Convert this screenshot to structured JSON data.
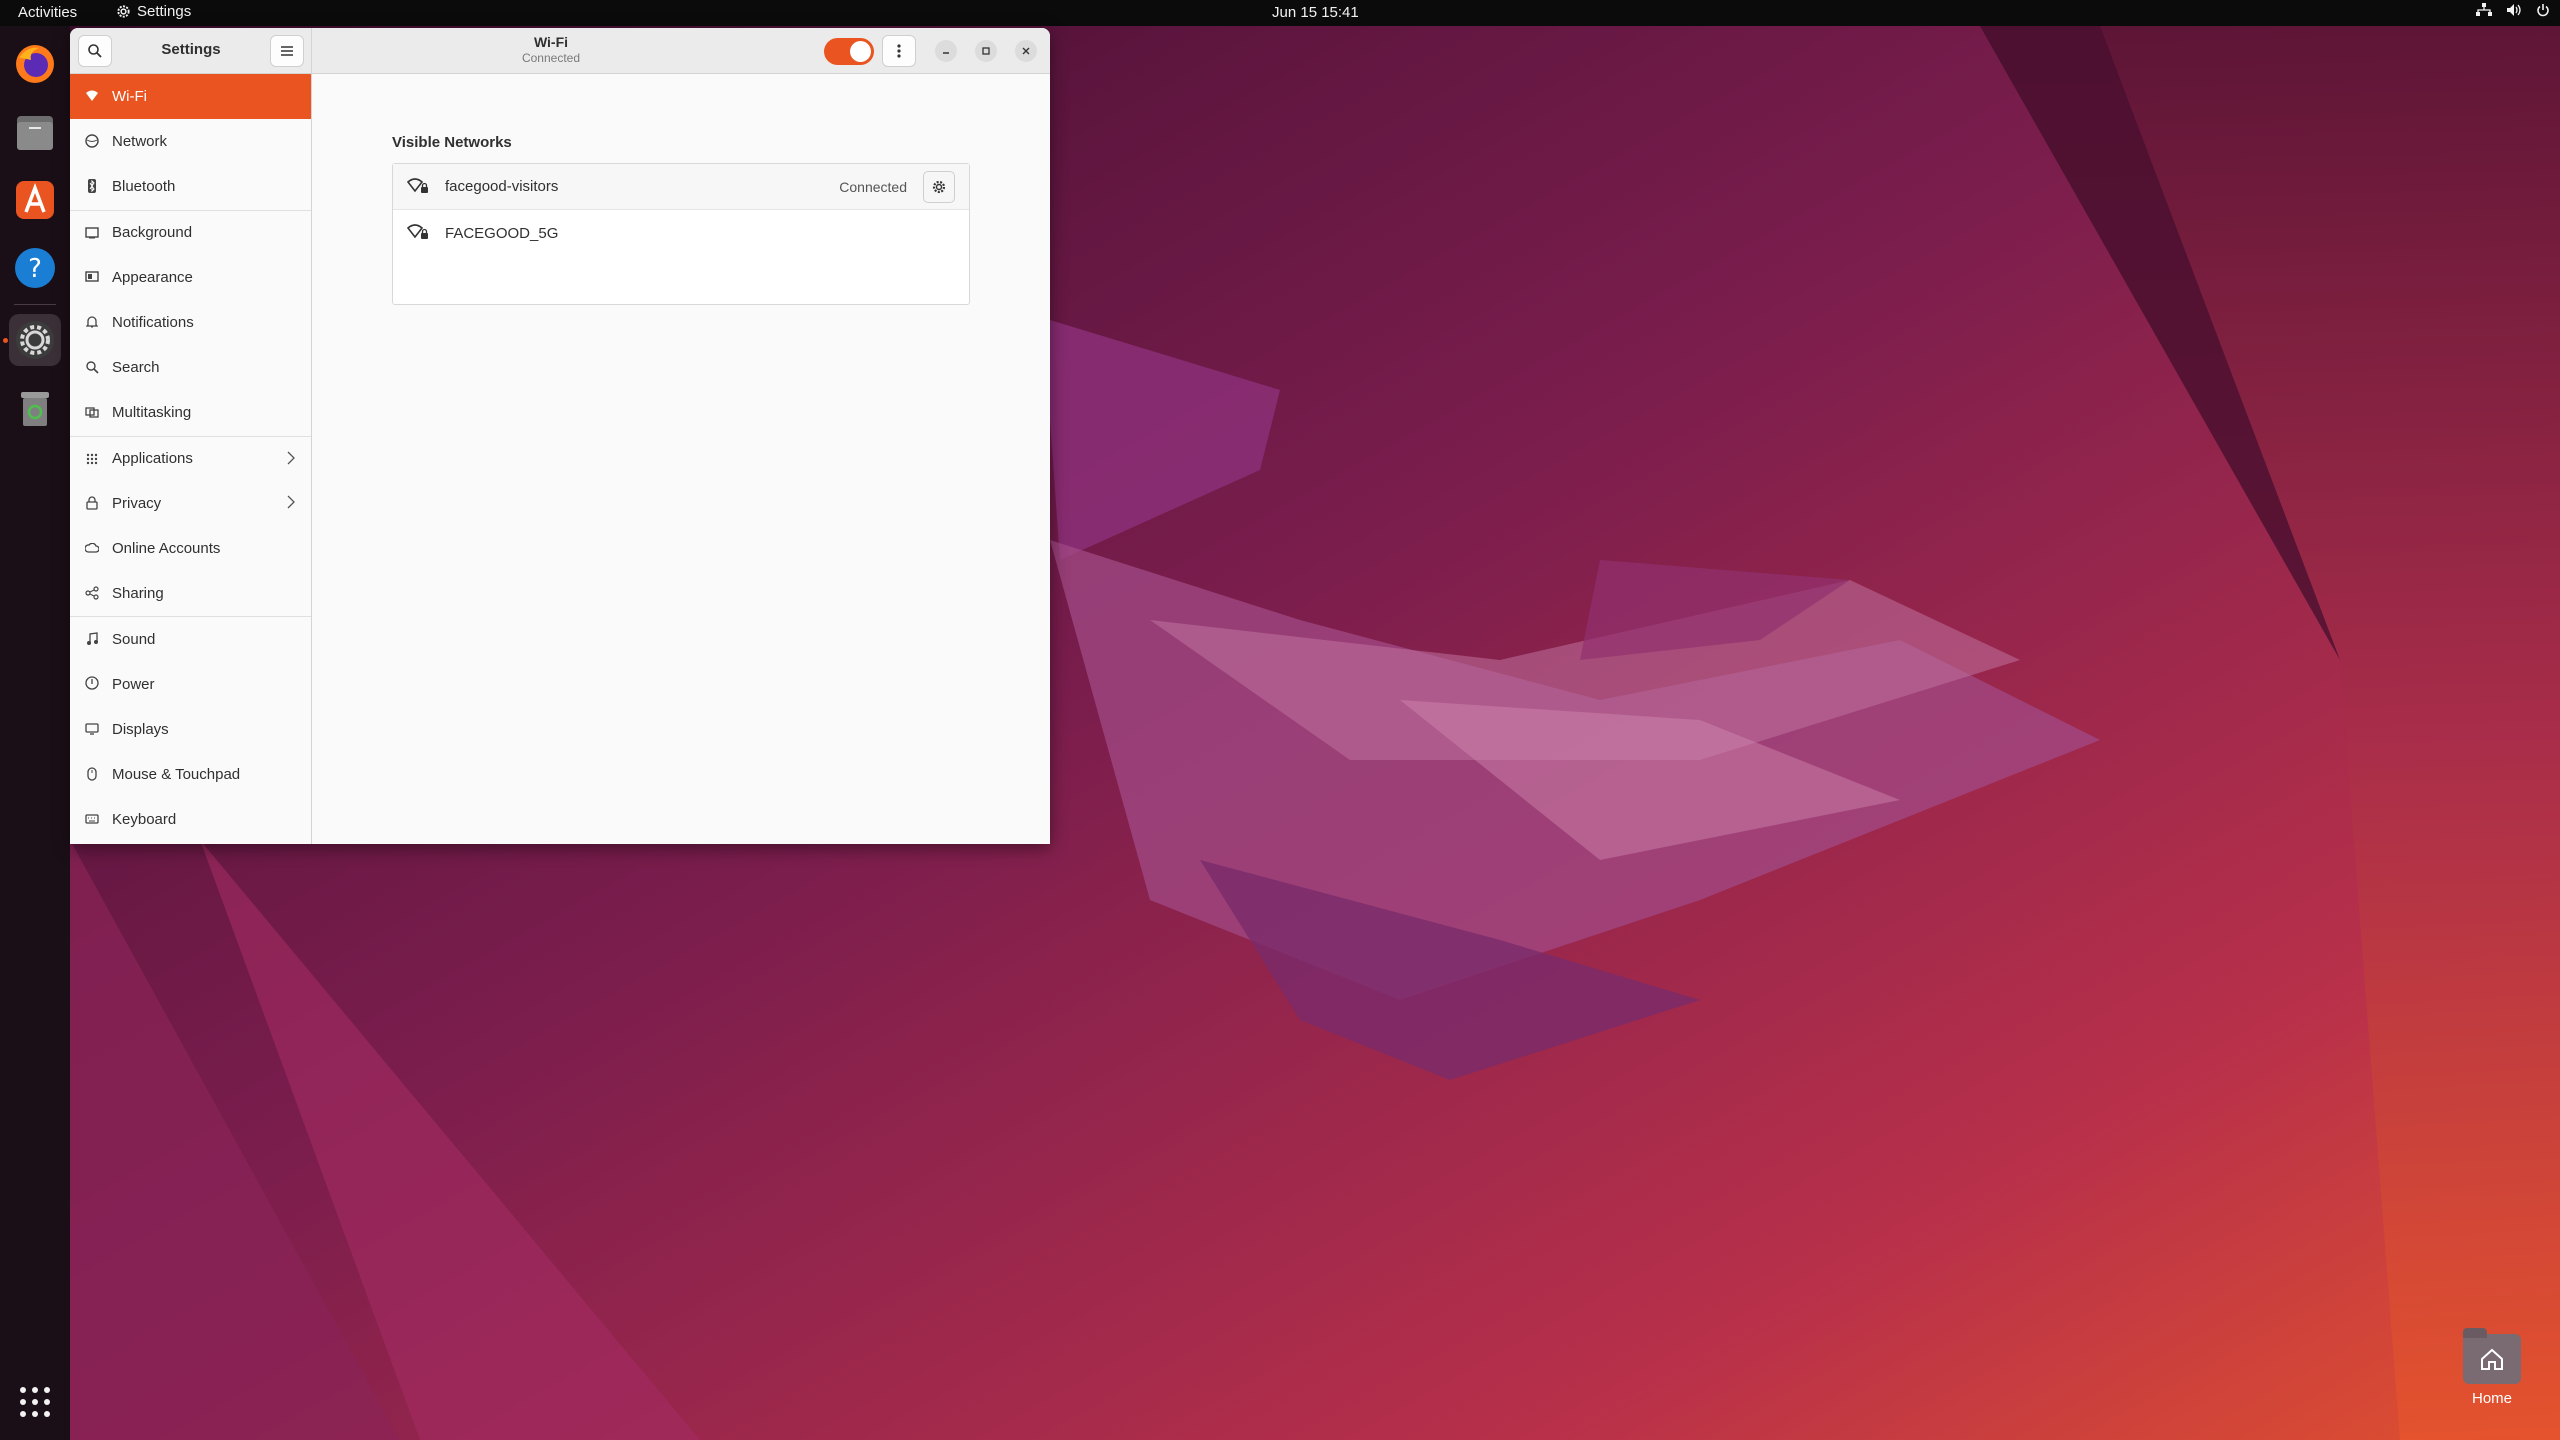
{
  "topbar": {
    "activities": "Activities",
    "app_name": "Settings",
    "clock": "Jun 15  15:41"
  },
  "dock": {
    "items": [
      {
        "name": "firefox-icon"
      },
      {
        "name": "files-icon"
      },
      {
        "name": "app-center-icon"
      },
      {
        "name": "help-icon"
      },
      {
        "name": "settings-icon",
        "active": true
      },
      {
        "name": "trash-icon"
      }
    ]
  },
  "desktop": {
    "home_label": "Home"
  },
  "window": {
    "sidebar_title": "Settings",
    "page_title": "Wi-Fi",
    "page_subtitle": "Connected",
    "wifi_enabled": true
  },
  "sidebar": {
    "items": [
      {
        "label": "Wi-Fi",
        "icon": "wifi-icon"
      },
      {
        "label": "Network",
        "icon": "network-icon"
      },
      {
        "label": "Bluetooth",
        "icon": "bluetooth-icon"
      },
      {
        "label": "Background",
        "icon": "background-icon"
      },
      {
        "label": "Appearance",
        "icon": "appearance-icon"
      },
      {
        "label": "Notifications",
        "icon": "bell-icon"
      },
      {
        "label": "Search",
        "icon": "search-icon"
      },
      {
        "label": "Multitasking",
        "icon": "multitasking-icon"
      },
      {
        "label": "Applications",
        "icon": "grid-icon"
      },
      {
        "label": "Privacy",
        "icon": "lock-icon"
      },
      {
        "label": "Online Accounts",
        "icon": "cloud-icon"
      },
      {
        "label": "Sharing",
        "icon": "share-icon"
      },
      {
        "label": "Sound",
        "icon": "music-note-icon"
      },
      {
        "label": "Power",
        "icon": "power-icon"
      },
      {
        "label": "Displays",
        "icon": "display-icon"
      },
      {
        "label": "Mouse & Touchpad",
        "icon": "mouse-icon"
      },
      {
        "label": "Keyboard",
        "icon": "keyboard-icon"
      }
    ]
  },
  "content": {
    "section_title": "Visible Networks",
    "networks": [
      {
        "ssid": "facegood-visitors",
        "status": "Connected"
      },
      {
        "ssid": "FACEGOOD_5G",
        "status": ""
      }
    ]
  },
  "colors": {
    "accent": "#e95420",
    "topbar": "#0b0b0b",
    "dock": "#1b0f17"
  }
}
